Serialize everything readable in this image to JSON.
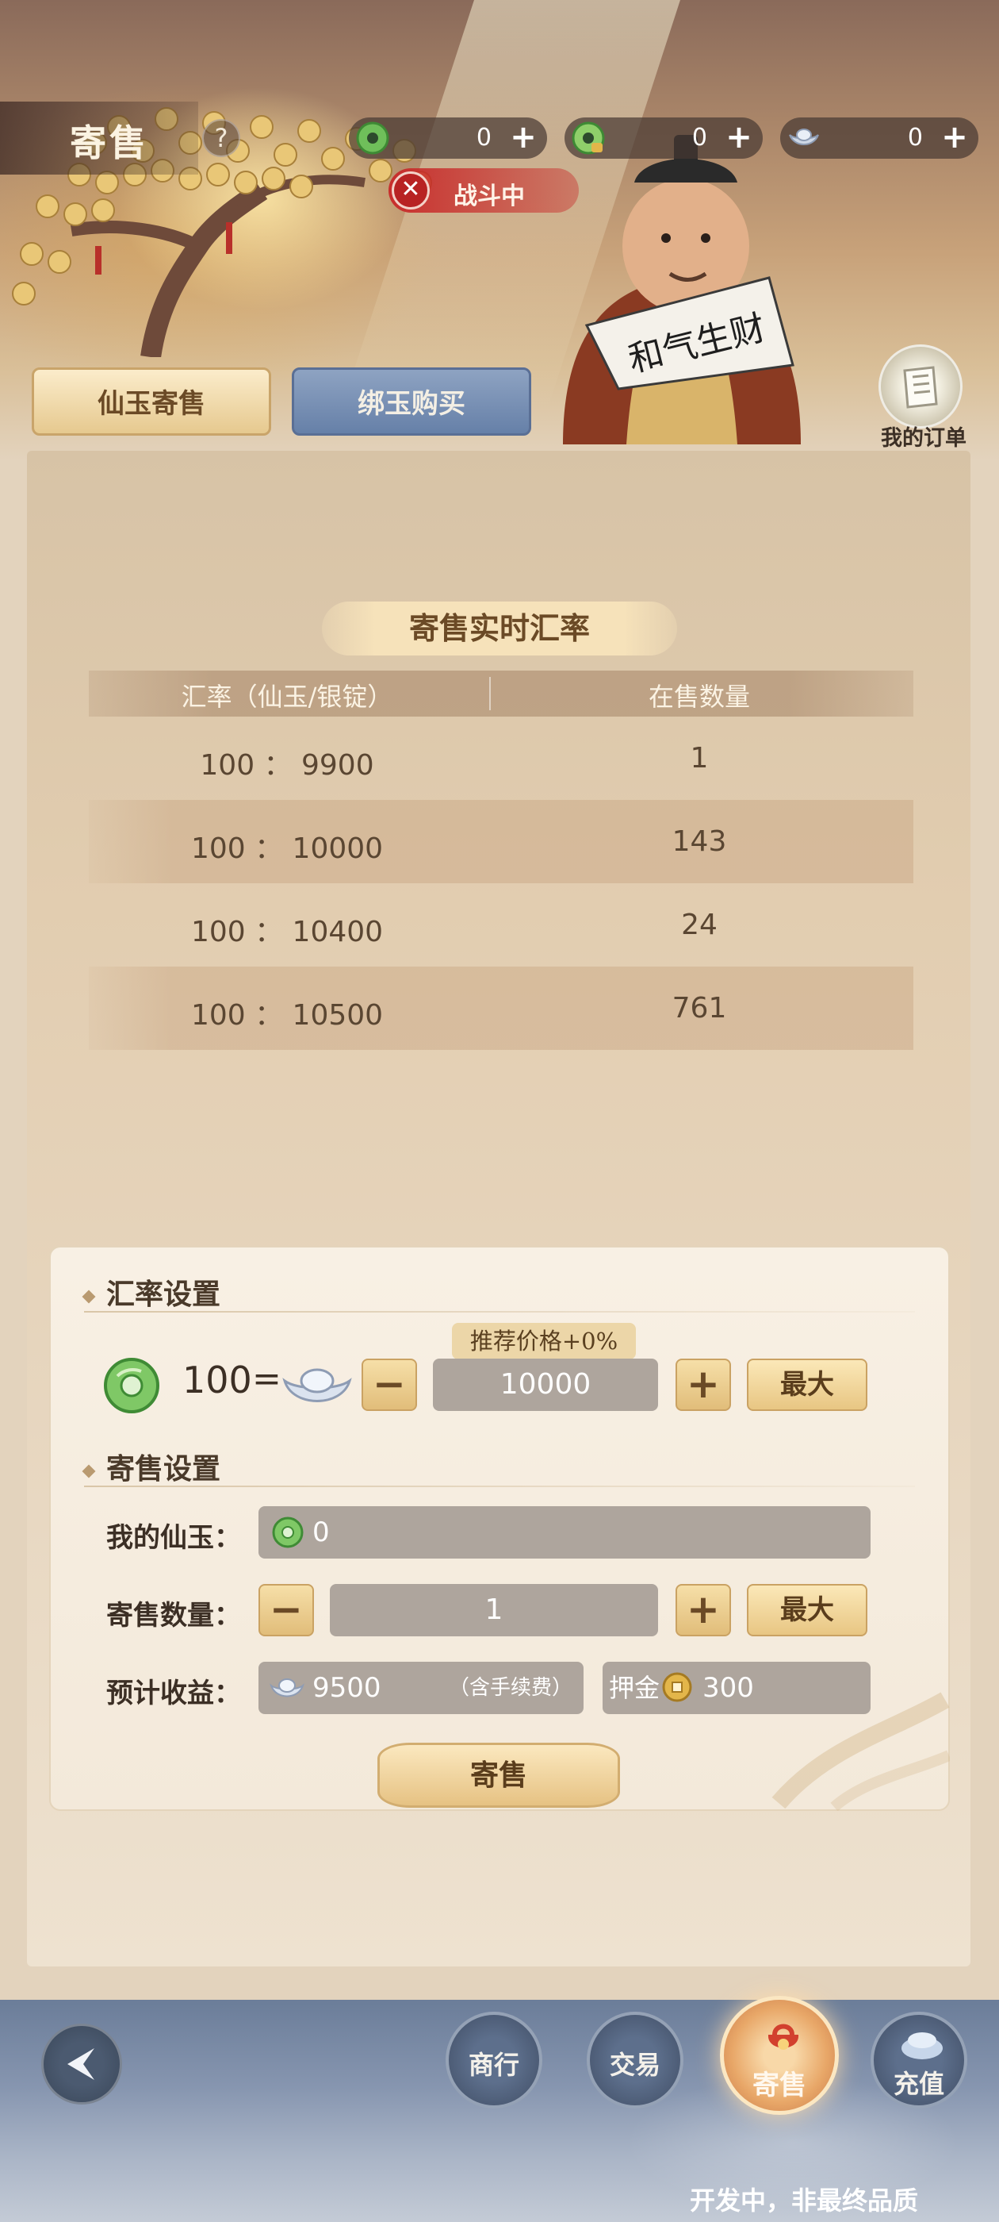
{
  "header": {
    "title": "寄售",
    "help_label": "?",
    "currencies": [
      {
        "icon": "jade-coin-icon",
        "value": "0",
        "plus": "+"
      },
      {
        "icon": "bound-jade-coin-icon",
        "value": "0",
        "plus": "+"
      },
      {
        "icon": "silver-ingot-icon",
        "value": "0",
        "plus": "+"
      }
    ],
    "status": {
      "icon": "close-icon",
      "glyph": "✕",
      "label": "战斗中"
    },
    "fan_text": "和气生财"
  },
  "tabs": [
    {
      "label": "仙玉寄售",
      "active": true
    },
    {
      "label": "绑玉购买",
      "active": false
    }
  ],
  "orders": {
    "label": "我的订单"
  },
  "rate_table": {
    "title": "寄售实时汇率",
    "columns": [
      "汇率（仙玉/银锭）",
      "在售数量"
    ],
    "rows": [
      {
        "rate": "100 ： 9900",
        "count": "1"
      },
      {
        "rate": "100 ： 10000",
        "count": "143"
      },
      {
        "rate": "100 ： 10400",
        "count": "24"
      },
      {
        "rate": "100 ： 10500",
        "count": "761"
      }
    ]
  },
  "rate_setting": {
    "section_title": "汇率设置",
    "recommend_tag": "推荐价格+0%",
    "jade_amount": "100",
    "equals": "=",
    "minus": "−",
    "plus": "+",
    "price_value": "10000",
    "max_label": "最大"
  },
  "sell_setting": {
    "section_title": "寄售设置",
    "my_jade_label": "我的仙玉：",
    "my_jade_value": "0",
    "quantity_label": "寄售数量：",
    "quantity_value": "1",
    "minus": "−",
    "plus": "+",
    "max_label": "最大",
    "income_label": "预计收益：",
    "income_value": "9500",
    "income_note": "（含手续费）",
    "deposit_label": "押金",
    "deposit_value": "300",
    "submit_label": "寄售"
  },
  "bottom_nav": {
    "items": [
      {
        "label": "商行",
        "active": false
      },
      {
        "label": "交易",
        "active": false
      },
      {
        "label": "寄售",
        "active": true
      },
      {
        "label": "充值",
        "active": false
      }
    ],
    "dev_note": "开发中，非最终品质"
  },
  "colors": {
    "accent_gold": "#e6c283",
    "panel_bg": "#e2cdb0",
    "field_gray": "#aea59d",
    "jade_green": "#6fbf5a",
    "battle_red": "#c82828"
  }
}
